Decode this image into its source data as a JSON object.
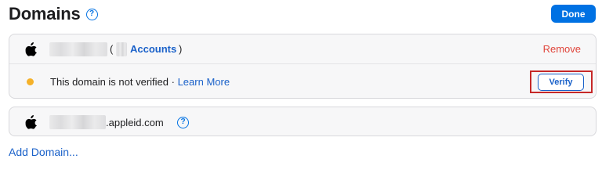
{
  "header": {
    "title": "Domains",
    "done_label": "Done"
  },
  "domains": [
    {
      "blurred_name": "",
      "paren_open": "(",
      "accounts_label": "Accounts",
      "paren_close": ")",
      "remove_label": "Remove",
      "status_text": "This domain is not verified · ",
      "learn_more_label": "Learn More",
      "verify_label": "Verify"
    },
    {
      "domain_suffix": ".appleid.com"
    }
  ],
  "footer": {
    "add_domain_label": "Add Domain..."
  },
  "colors": {
    "accent": "#0071e3",
    "link": "#1a61c9",
    "destructive": "#e0453b",
    "warning": "#f5b129",
    "highlight": "#c62828"
  },
  "icons": {
    "help": "question-circle-icon",
    "apple": "apple-logo-icon"
  }
}
